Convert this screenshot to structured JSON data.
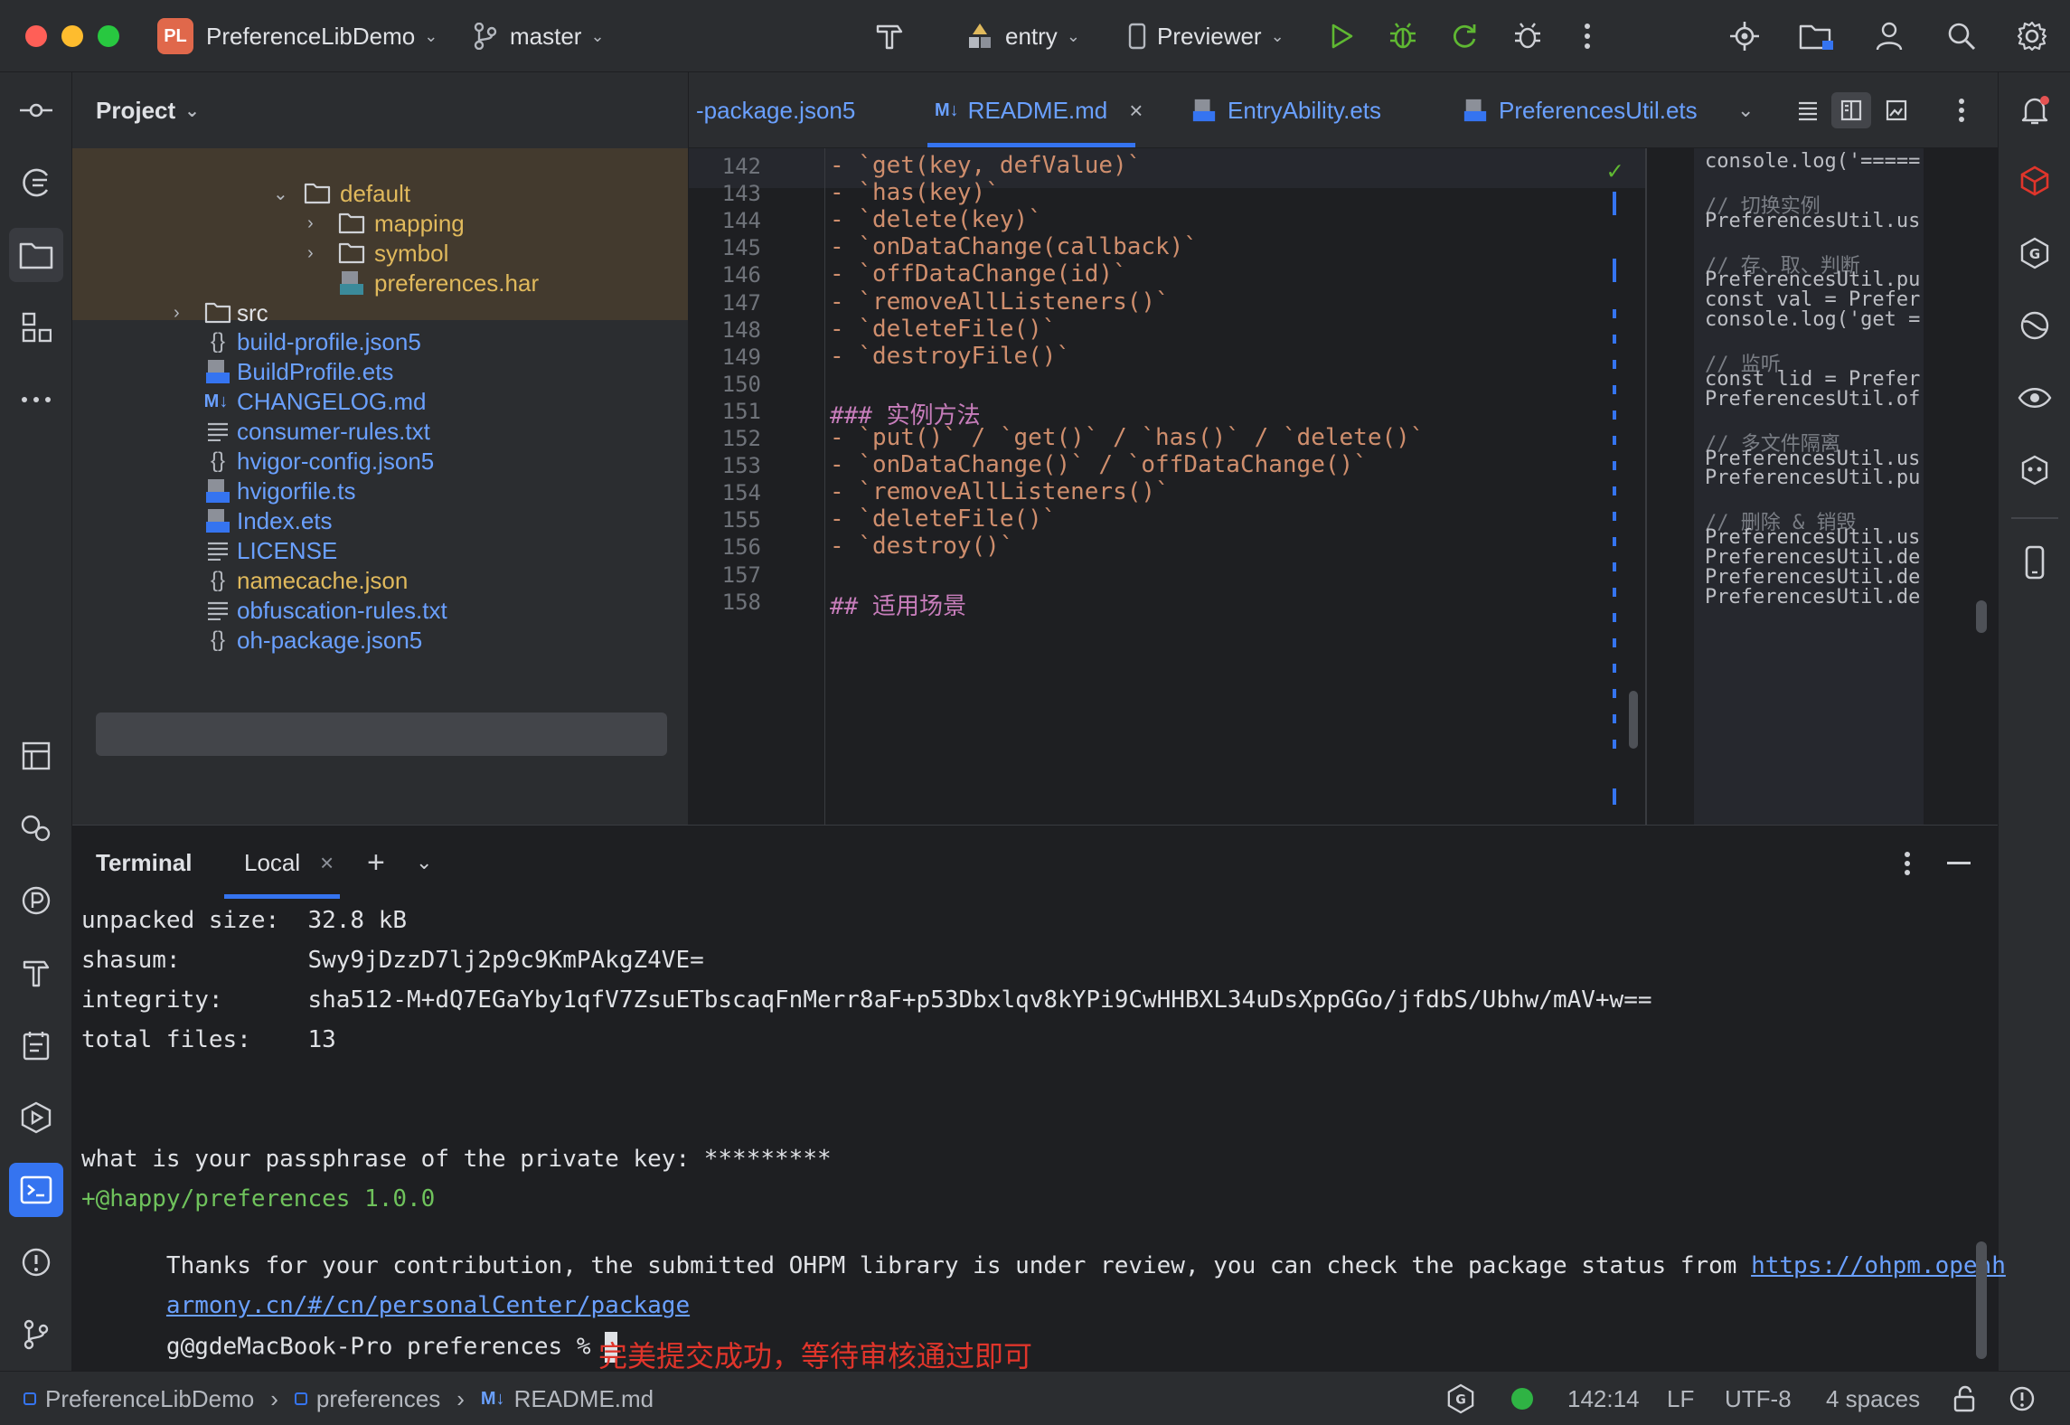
{
  "titlebar": {
    "project_badge": "PL",
    "project_name": "PreferenceLibDemo",
    "branch": "master",
    "run_config": "entry",
    "device": "Previewer"
  },
  "project_panel": {
    "title": "Project",
    "tree": [
      {
        "label": "default",
        "type": "folder",
        "expanded": true
      },
      {
        "label": "mapping",
        "type": "folder",
        "expanded": false
      },
      {
        "label": "symbol",
        "type": "folder",
        "expanded": false
      },
      {
        "label": "preferences.har",
        "type": "har"
      },
      {
        "label": "src",
        "type": "folder",
        "expanded": false
      },
      {
        "label": "build-profile.json5",
        "type": "json"
      },
      {
        "label": "BuildProfile.ets",
        "type": "ets"
      },
      {
        "label": "CHANGELOG.md",
        "type": "md"
      },
      {
        "label": "consumer-rules.txt",
        "type": "txt"
      },
      {
        "label": "hvigor-config.json5",
        "type": "json"
      },
      {
        "label": "hvigorfile.ts",
        "type": "ts"
      },
      {
        "label": "Index.ets",
        "type": "ets"
      },
      {
        "label": "LICENSE",
        "type": "txt"
      },
      {
        "label": "namecache.json",
        "type": "json",
        "selected": true
      },
      {
        "label": "obfuscation-rules.txt",
        "type": "txt"
      },
      {
        "label": "oh-package.json5",
        "type": "json"
      }
    ]
  },
  "tabs": [
    {
      "label": "-package.json5"
    },
    {
      "label": "README.md",
      "active": true
    },
    {
      "label": "EntryAbility.ets"
    },
    {
      "label": "PreferencesUtil.ets"
    }
  ],
  "editor": {
    "lines": [
      {
        "n": "142",
        "code": "- `get(key, defValue)`"
      },
      {
        "n": "143",
        "code": "- `has(key)`"
      },
      {
        "n": "144",
        "code": "- `delete(key)`"
      },
      {
        "n": "145",
        "code": "- `onDataChange(callback)`"
      },
      {
        "n": "146",
        "code": "- `offDataChange(id)`"
      },
      {
        "n": "147",
        "code": "- `removeAllListeners()`"
      },
      {
        "n": "148",
        "code": "- `deleteFile()`"
      },
      {
        "n": "149",
        "code": "- `destroyFile()`"
      },
      {
        "n": "150",
        "code": ""
      },
      {
        "n": "151",
        "code": "### 实例方法"
      },
      {
        "n": "152",
        "code": "- `put()` / `get()` / `has()` / `delete()`"
      },
      {
        "n": "153",
        "code": "- `onDataChange()` / `offDataChange()`"
      },
      {
        "n": "154",
        "code": "- `removeAllListeners()`"
      },
      {
        "n": "155",
        "code": "- `deleteFile()`"
      },
      {
        "n": "156",
        "code": "- `destroy()`"
      },
      {
        "n": "157",
        "code": ""
      },
      {
        "n": "158",
        "code": "## 适用场景"
      }
    ]
  },
  "preview": {
    "lines": [
      {
        "text": "console.log('=====",
        "comment": false
      },
      {
        "text": "",
        "comment": false
      },
      {
        "text": "// 切换实例",
        "comment": true
      },
      {
        "text": "PreferencesUtil.us",
        "comment": false
      },
      {
        "text": "",
        "comment": false
      },
      {
        "text": "// 存、取、判断",
        "comment": true
      },
      {
        "text": "PreferencesUtil.pu",
        "comment": false
      },
      {
        "text": "const val = Prefer",
        "comment": false
      },
      {
        "text": "console.log('get =",
        "comment": false
      },
      {
        "text": "",
        "comment": false
      },
      {
        "text": "// 监听",
        "comment": true
      },
      {
        "text": "const lid = Prefer",
        "comment": false
      },
      {
        "text": "PreferencesUtil.of",
        "comment": false
      },
      {
        "text": "",
        "comment": false
      },
      {
        "text": "// 多文件隔离",
        "comment": true
      },
      {
        "text": "PreferencesUtil.us",
        "comment": false
      },
      {
        "text": "PreferencesUtil.pu",
        "comment": false
      },
      {
        "text": "",
        "comment": false
      },
      {
        "text": "// 删除 & 销毁",
        "comment": true
      },
      {
        "text": "PreferencesUtil.us",
        "comment": false
      },
      {
        "text": "PreferencesUtil.de",
        "comment": false
      },
      {
        "text": "PreferencesUtil.de",
        "comment": false
      },
      {
        "text": "PreferencesUtil.de",
        "comment": false
      }
    ]
  },
  "terminal": {
    "title": "Terminal",
    "tab": "Local",
    "lines": [
      "unpacked size:  32.8 kB",
      "shasum:         Swy9jDzzD7lj2p9c9KmPAkgZ4VE=",
      "integrity:      sha512-M+dQ7EGaYby1qfV7ZsuETbscaqFnMerr8aF+p53Dbxlqv8kYPi9CwHHBXL34uDsXppGGo/jfdbS/Ubhw/mAV+w==",
      "total files:    13",
      "",
      "",
      "what is your passphrase of the private key: *********",
      "+@happy/preferences 1.0.0",
      "Thanks for your contribution, the submitted OHPM library is under review, you can check the package status from ",
      "",
      "g@gdeMacBook-Pro preferences % "
    ],
    "link_part1": "https://ohpm.openh",
    "link_part2": "armony.cn/#/cn/personalCenter/package",
    "annotation": "完美提交成功，等待审核通过即可"
  },
  "statusbar": {
    "crumbs": [
      "PreferenceLibDemo",
      "preferences",
      "README.md"
    ],
    "position": "142:14",
    "line_sep": "LF",
    "encoding": "UTF-8",
    "indent": "4 spaces"
  },
  "colors": {
    "accent": "#3574f0",
    "link": "#6aa0ff",
    "green": "#5fb832",
    "annotation": "#e0352b",
    "badge": "#e0684b"
  }
}
